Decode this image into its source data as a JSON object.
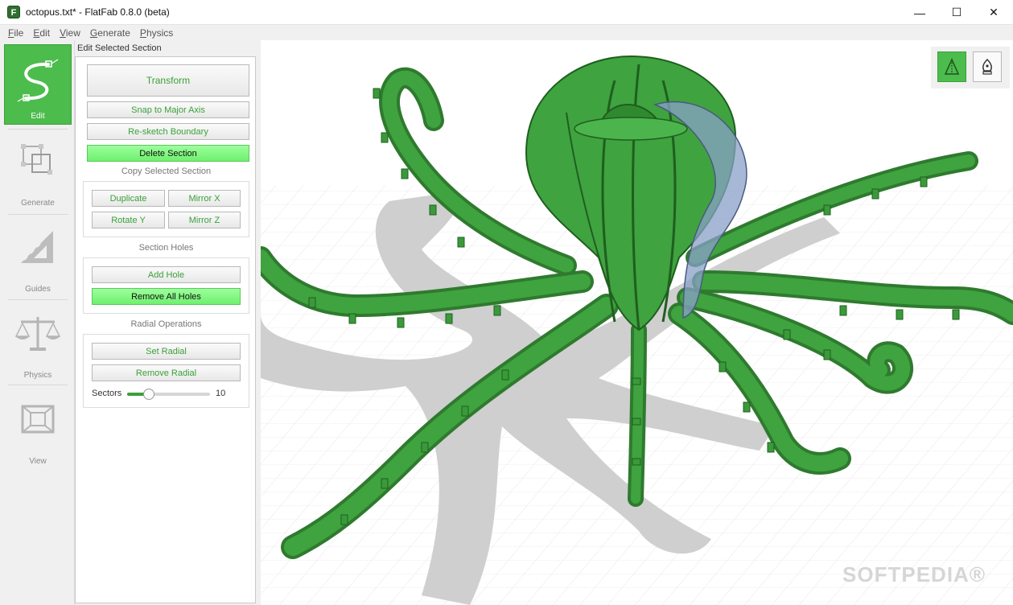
{
  "window": {
    "title": "octopus.txt* - FlatFab 0.8.0 (beta)",
    "app_icon_letter": "F",
    "minimize_glyph": "—",
    "maximize_glyph": "☐",
    "close_glyph": "✕"
  },
  "menu": {
    "file": {
      "u": "F",
      "rest": "ile"
    },
    "edit": {
      "u": "E",
      "rest": "dit"
    },
    "view": {
      "u": "V",
      "rest": "iew"
    },
    "generate": {
      "u": "G",
      "rest": "enerate"
    },
    "physics": {
      "u": "P",
      "rest": "hysics"
    }
  },
  "rail": {
    "edit": "Edit",
    "generate": "Generate",
    "guides": "Guides",
    "physics": "Physics",
    "view": "View"
  },
  "panel": {
    "title": "Edit Selected Section",
    "transform": "Transform",
    "snap": "Snap to Major Axis",
    "resketch": "Re-sketch Boundary",
    "delete": "Delete Section",
    "copy_label": "Copy Selected Section",
    "duplicate": "Duplicate",
    "mirror_x": "Mirror X",
    "rotate_y": "Rotate Y",
    "mirror_z": "Mirror Z",
    "holes_label": "Section Holes",
    "add_hole": "Add Hole",
    "remove_holes": "Remove All Holes",
    "radial_label": "Radial Operations",
    "set_radial": "Set Radial",
    "remove_radial": "Remove Radial",
    "sectors_label": "Sectors",
    "sectors_value": "10"
  },
  "viewport": {
    "watermark": "SOFTPEDIA®"
  },
  "colors": {
    "accent_green": "#4cbc4c",
    "model_green": "#3a9a3a",
    "selected_blue": "#8aa0c8"
  }
}
